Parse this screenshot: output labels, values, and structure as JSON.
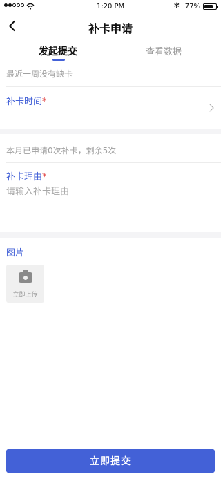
{
  "status_bar": {
    "time": "1:20 PM",
    "battery_percent": "77%",
    "battery_level": 0.77,
    "bluetooth_glyph": "✻"
  },
  "nav": {
    "title": "补卡申请",
    "back_icon": "chevron-left-icon"
  },
  "tabs": [
    {
      "label": "发起提交",
      "active": true
    },
    {
      "label": "查看数据",
      "active": false
    }
  ],
  "form": {
    "recent_hint": "最近一周没有缺卡",
    "time_field": {
      "label": "补卡时间",
      "required_mark": "*"
    },
    "monthly_hint": "本月已申请0次补卡，剩余5次",
    "reason_field": {
      "label": "补卡理由",
      "required_mark": "*",
      "placeholder": "请输入补卡理由",
      "value": ""
    },
    "image_section": {
      "label": "图片",
      "upload_label": "立即上传",
      "icon": "camera-icon"
    }
  },
  "submit_button": {
    "label": "立即提交"
  },
  "colors": {
    "accent": "#4361d7",
    "required": "#e04040",
    "hint": "#a0a0a0",
    "section_gap": "#f4f4f6"
  }
}
